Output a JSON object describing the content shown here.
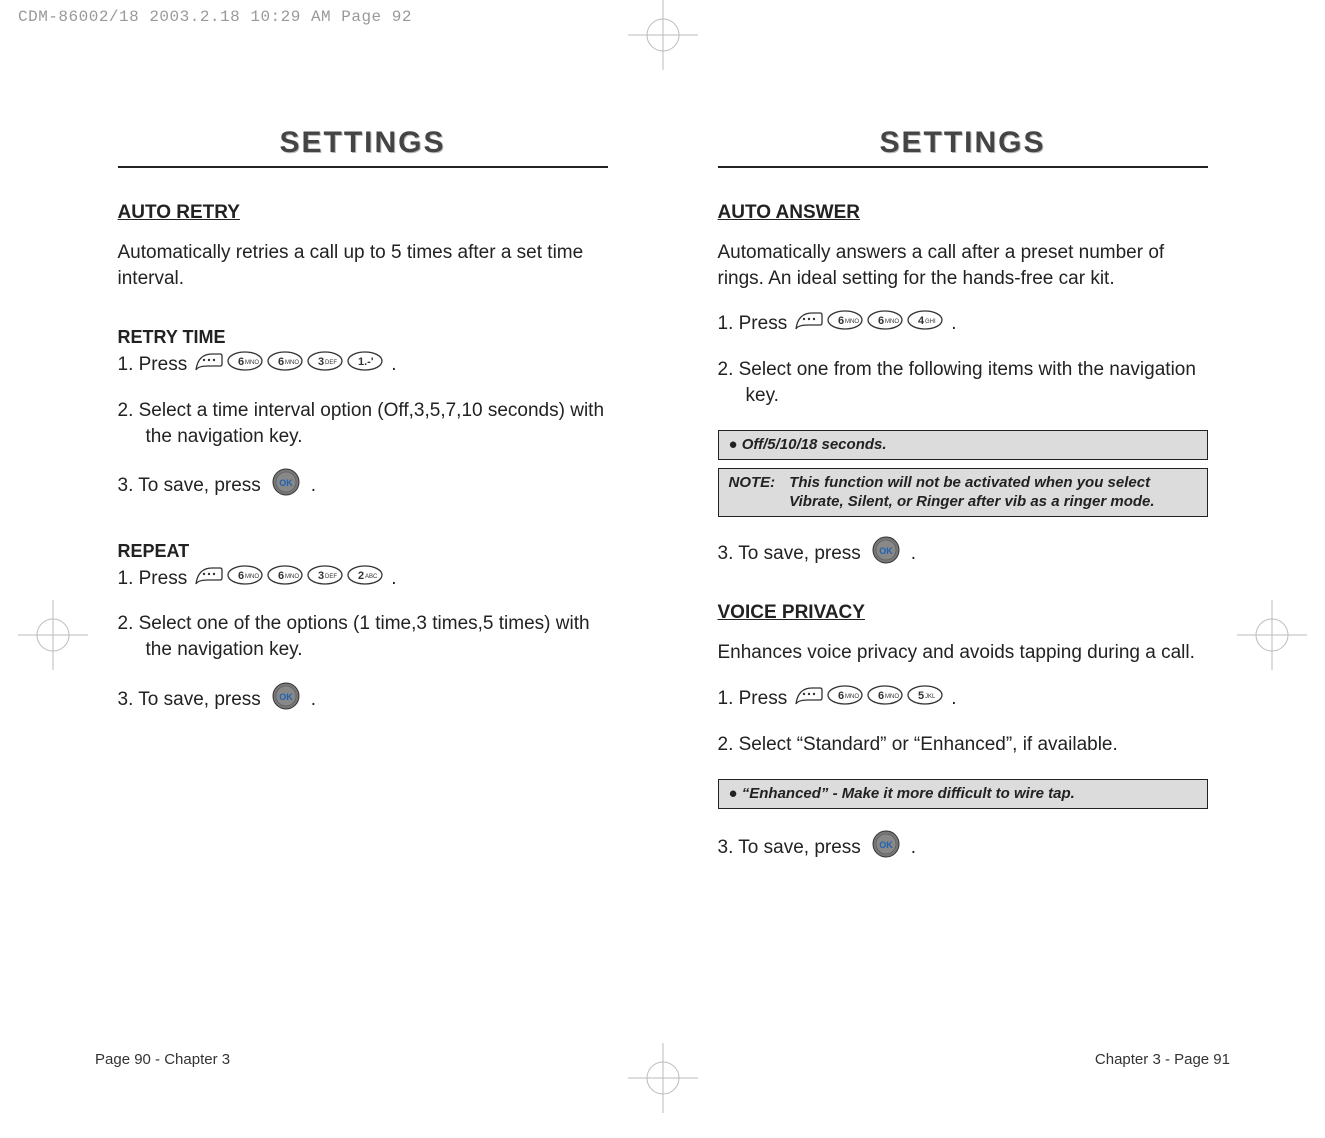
{
  "print_header": "CDM-86002/18  2003.2.18  10:29 AM  Page 92",
  "left": {
    "title": "SETTINGS",
    "h_auto_retry": "AUTO RETRY",
    "auto_retry_desc": "Automatically retries a call up to 5 times after a set time interval.",
    "h_retry_time": "RETRY TIME",
    "retry_press": "1. Press",
    "retry_keys": [
      "soft",
      "6",
      "6",
      "3",
      "1"
    ],
    "retry_step2": "2. Select a time interval option (Off,3,5,7,10 seconds) with the navigation key.",
    "retry_step3": "3. To save, press",
    "h_repeat": "REPEAT",
    "repeat_press": "1. Press",
    "repeat_keys": [
      "soft",
      "6",
      "6",
      "3",
      "2"
    ],
    "repeat_step2": "2. Select one of the options (1 time,3 times,5 times) with the navigation key.",
    "repeat_step3": "3. To save, press",
    "footer": "Page 90 - Chapter 3"
  },
  "right": {
    "title": "SETTINGS",
    "h_auto_answer": "AUTO ANSWER",
    "auto_answer_desc": "Automatically answers a call after a preset number of rings. An ideal setting for the hands-free car kit.",
    "aa_press": "1. Press",
    "aa_keys": [
      "soft",
      "6",
      "6",
      "4"
    ],
    "aa_step2": "2. Select one from the following items with the navigation key.",
    "aa_box1": "Off/5/10/18 seconds.",
    "aa_note_label": "NOTE:",
    "aa_note_body": "This function will not be activated when you select Vibrate, Silent, or Ringer after vib as a ringer mode.",
    "aa_step3": "3. To save, press",
    "h_voice_privacy": "VOICE PRIVACY",
    "vp_desc": "Enhances voice privacy and avoids tapping during a call.",
    "vp_press": "1. Press",
    "vp_keys": [
      "soft",
      "6",
      "6",
      "5"
    ],
    "vp_step2": "2. Select “Standard” or “Enhanced”, if available.",
    "vp_box": "“Enhanced” - Make it more difficult to wire tap.",
    "vp_step3": "3. To save, press",
    "footer": "Chapter 3 - Page 91"
  },
  "period": ".",
  "keys": {
    "soft": "",
    "ok": "OK",
    "1": "1.-'",
    "2": "2 ABC",
    "3": "3 DEF",
    "4": "4 GHI",
    "5": "5 JKL",
    "6": "6 MNO"
  }
}
